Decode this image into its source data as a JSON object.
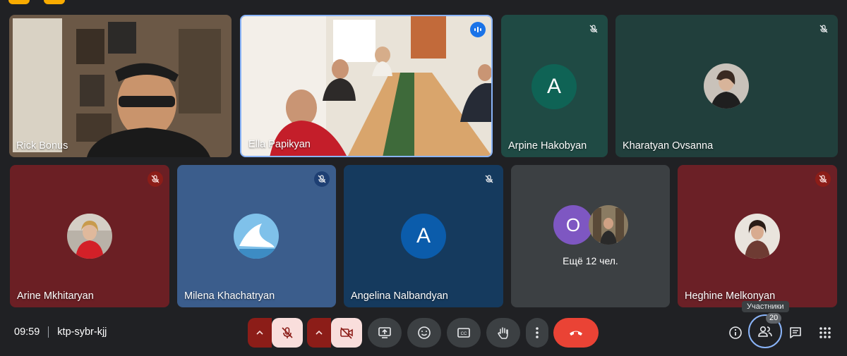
{
  "participants": [
    {
      "name": "Rick Bonus",
      "muted": false
    },
    {
      "name": "Ella Papikyan",
      "speaking": true
    },
    {
      "name": "Arpine Hakobyan",
      "muted": true,
      "avatar_letter": "A"
    },
    {
      "name": "Kharatyan Ovsanna",
      "muted": true
    },
    {
      "name": "Arine Mkhitaryan",
      "muted": true
    },
    {
      "name": "Milena Khachatryan",
      "muted": true
    },
    {
      "name": "Angelina Nalbandyan",
      "muted": true,
      "avatar_letter": "A"
    },
    {
      "name": "Heghine Melkonyan",
      "muted": true
    }
  ],
  "overflow": {
    "text": "Ещё 12 чел.",
    "avatar_letter": "O"
  },
  "meeting": {
    "time": "09:59",
    "code": "ktp-sybr-kjj"
  },
  "people": {
    "tooltip": "Участники",
    "count": "20"
  },
  "controls": {
    "mic": "mic-off-icon",
    "camera": "camera-off-icon",
    "present": "present-screen-icon",
    "emoji": "emoji-icon",
    "captions": "captions-icon",
    "raise_hand": "hand-icon",
    "more": "more-vert-icon",
    "end_call": "end-call-icon",
    "info": "info-icon",
    "people": "people-icon",
    "chat": "chat-icon",
    "activities": "apps-icon"
  },
  "colors": {
    "end_call": "#ea4335",
    "active_ring": "#8ab4f8",
    "muted_pill": "#f9dedc"
  }
}
